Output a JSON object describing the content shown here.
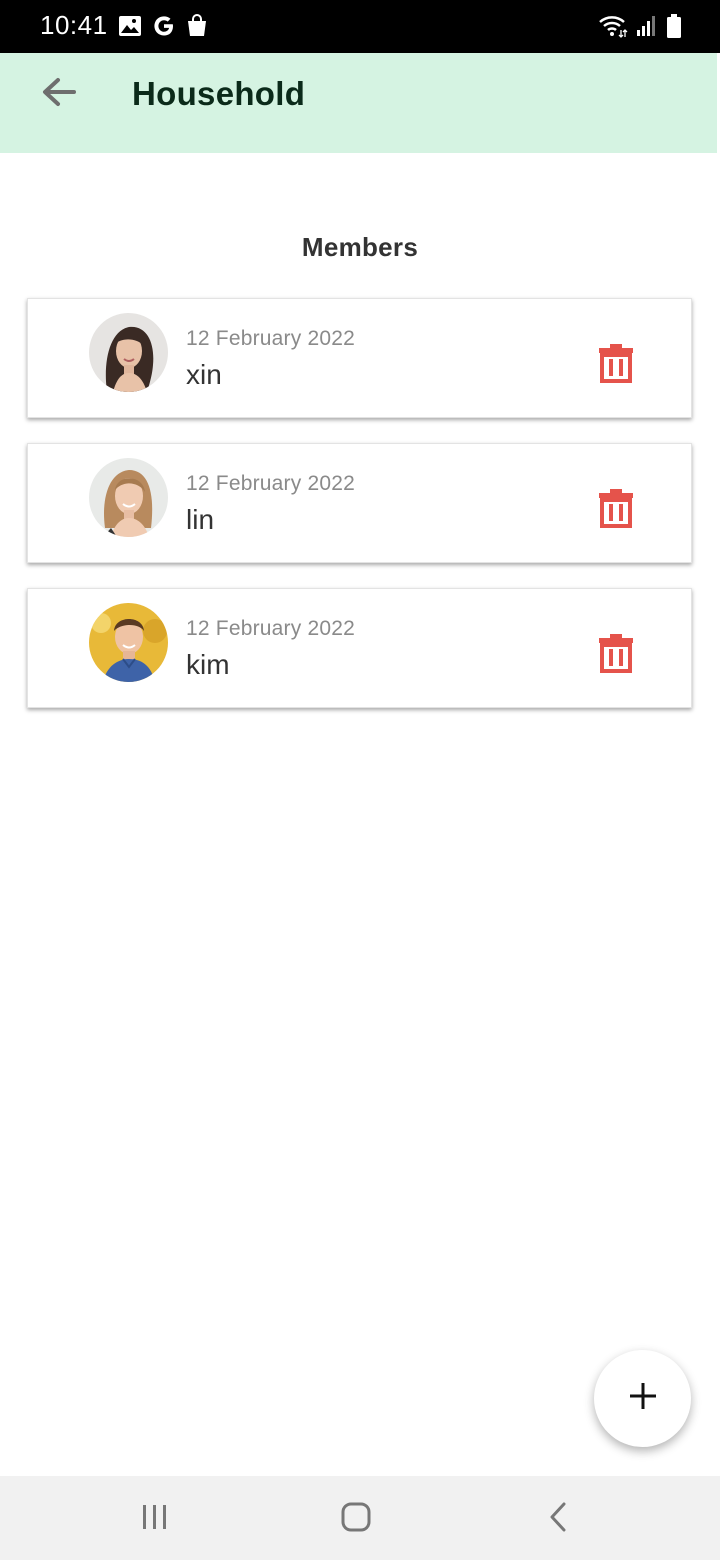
{
  "status_bar": {
    "time": "10:41",
    "left_icons": [
      "image-icon",
      "google-icon",
      "shopping-bag-icon"
    ],
    "right_icons": [
      "wifi-icon",
      "signal-icon",
      "battery-icon"
    ]
  },
  "app_bar": {
    "title": "Household",
    "back_icon": "arrow-left-icon",
    "background_color": "#d5f3e2"
  },
  "section": {
    "title": "Members"
  },
  "members": [
    {
      "date": "12 February 2022",
      "name": "xin",
      "avatar": "avatar-woman-dark-hair"
    },
    {
      "date": "12 February 2022",
      "name": "lin",
      "avatar": "avatar-woman-blonde"
    },
    {
      "date": "12 February 2022",
      "name": "kim",
      "avatar": "avatar-young-man"
    }
  ],
  "delete_icon": "trash-icon",
  "delete_color": "#e5534b",
  "fab": {
    "icon": "plus-icon"
  },
  "nav_bar": {
    "buttons": [
      "recent-apps-icon",
      "home-icon",
      "back-icon"
    ]
  }
}
